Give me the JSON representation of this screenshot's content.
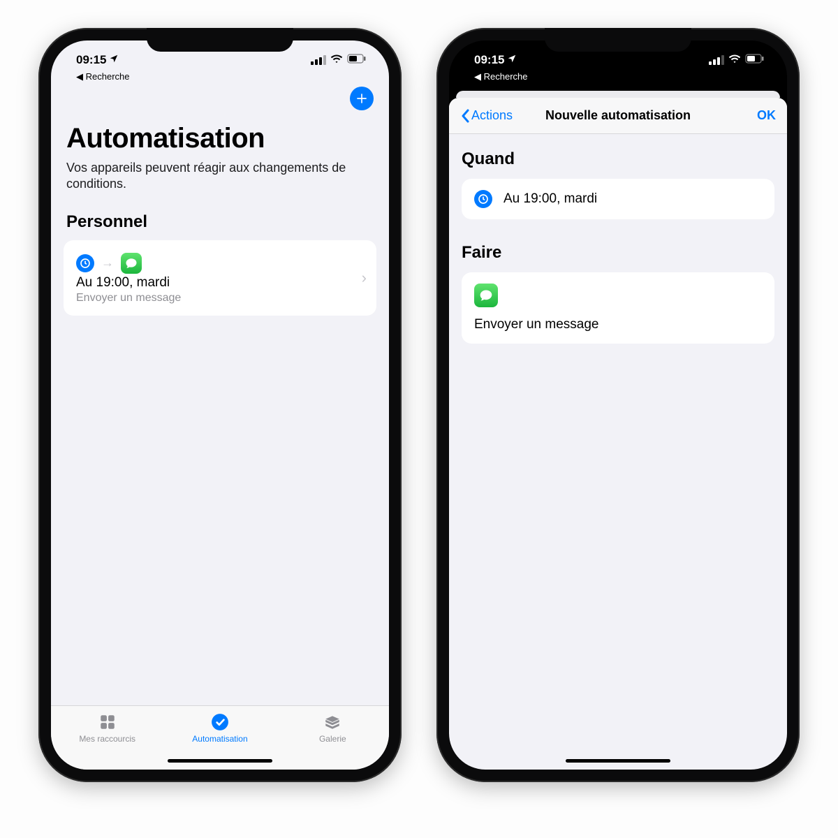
{
  "status": {
    "time": "09:15",
    "backapp": "Recherche"
  },
  "left": {
    "title": "Automatisation",
    "subtitle": "Vos appareils peuvent réagir aux changements de conditions.",
    "section": "Personnel",
    "item": {
      "title": "Au 19:00, mardi",
      "subtitle": "Envoyer un message"
    },
    "tabs": {
      "shortcuts": "Mes raccourcis",
      "automation": "Automatisation",
      "gallery": "Galerie"
    }
  },
  "right": {
    "nav": {
      "back": "Actions",
      "title": "Nouvelle automatisation",
      "done": "OK"
    },
    "when_h": "Quand",
    "when_text": "Au 19:00, mardi",
    "do_h": "Faire",
    "do_text": "Envoyer un message"
  }
}
